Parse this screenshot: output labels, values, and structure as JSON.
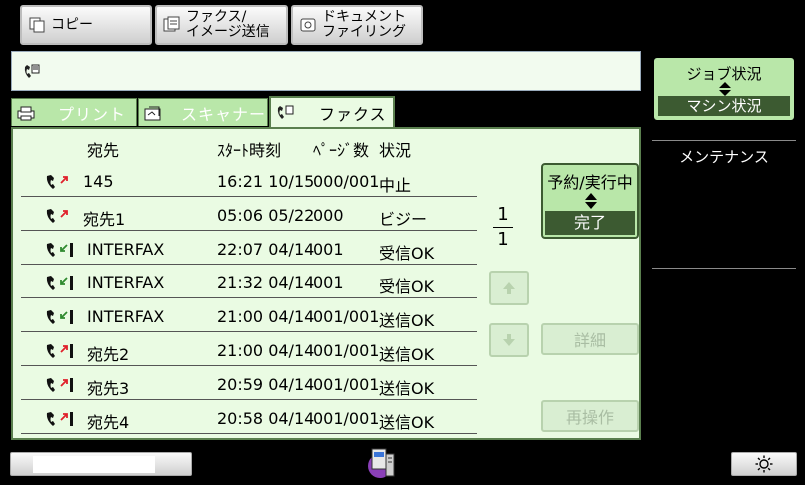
{
  "top_tabs": [
    {
      "label": "コピー"
    },
    {
      "label_line1": "ファクス/",
      "label_line2": "イメージ送信"
    },
    {
      "label_line1": "ドキュメント",
      "label_line2": "ファイリング"
    }
  ],
  "job_tabs": [
    {
      "label": "プリント"
    },
    {
      "label": "スキャナー"
    },
    {
      "label": "ファクス"
    }
  ],
  "columns": {
    "destination": "宛先",
    "start_time": "ｽﾀｰﾄ時刻",
    "pages": "ﾍﾟｰｼﾞ数",
    "status": "状況"
  },
  "rows": [
    {
      "direction": "send",
      "destination": "145",
      "time": "16:21 10/15",
      "pages": "000/001",
      "status": "中止"
    },
    {
      "direction": "send",
      "destination": "宛先1",
      "time": "05:06 05/22",
      "pages": "000",
      "status": "ビジー"
    },
    {
      "direction": "receive",
      "destination": "INTERFAX",
      "time": "22:07 04/14",
      "pages": "001",
      "status": "受信OK"
    },
    {
      "direction": "receive",
      "destination": "INTERFAX",
      "time": "21:32 04/14",
      "pages": "001",
      "status": "受信OK"
    },
    {
      "direction": "receive",
      "destination": "INTERFAX",
      "time": "21:00 04/14",
      "pages": "001/001",
      "status": "送信OK"
    },
    {
      "direction": "send",
      "destination": "宛先2",
      "time": "21:00 04/14",
      "pages": "001/001",
      "status": "送信OK"
    },
    {
      "direction": "send",
      "destination": "宛先3",
      "time": "20:59 04/14",
      "pages": "001/001",
      "status": "送信OK"
    },
    {
      "direction": "send",
      "destination": "宛先4",
      "time": "20:58 04/14",
      "pages": "001/001",
      "status": "送信OK"
    }
  ],
  "pager": {
    "current": "1",
    "total": "1"
  },
  "queue_toggle": {
    "top": "予約/実行中",
    "bottom": "完了"
  },
  "details_button": "詳細",
  "retry_button": "再操作",
  "job_status": {
    "top": "ジョブ状況",
    "bottom": "マシン状況"
  },
  "maintenance": "メンテナンス",
  "colors": {
    "panel_bg": "#eafbe3",
    "tab_green": "#b9e7a9",
    "dark_green": "#3c5a31",
    "send_arrow": "#e0202b",
    "receive_arrow": "#2f8a2f"
  }
}
